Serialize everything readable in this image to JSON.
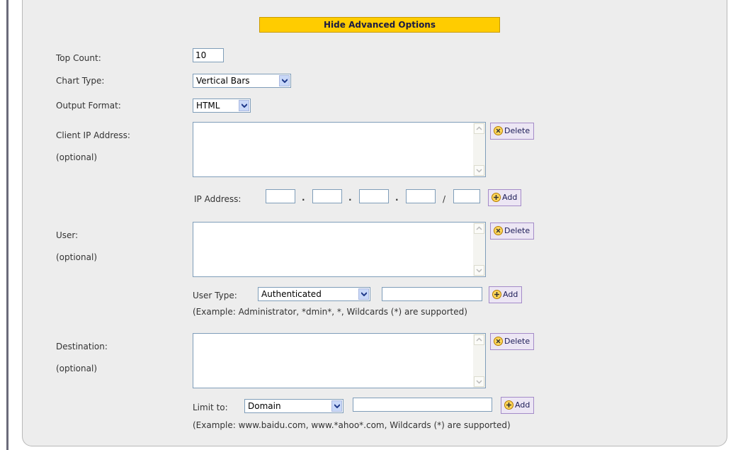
{
  "advanced_toggle": "Hide Advanced Options",
  "top_count": {
    "label": "Top Count:",
    "value": "10"
  },
  "chart_type": {
    "label": "Chart Type:",
    "value": "Vertical Bars"
  },
  "output_format": {
    "label": "Output Format:",
    "value": "HTML"
  },
  "client_ip": {
    "label": "Client IP Address:",
    "optional": "(optional)",
    "delete_label": "Delete",
    "ip_label": "IP Address:",
    "dot": ".",
    "slash": "/",
    "add_label": "Add"
  },
  "user": {
    "label": "User:",
    "optional": "(optional)",
    "delete_label": "Delete",
    "type_label": "User Type:",
    "type_value": "Authenticated",
    "add_label": "Add",
    "example": "(Example: Administrator, *dmin*, *, Wildcards (*) are supported)"
  },
  "destination": {
    "label": "Destination:",
    "optional": "(optional)",
    "delete_label": "Delete",
    "limit_label": "Limit to:",
    "limit_value": "Domain",
    "add_label": "Add",
    "example": "(Example: www.baidu.com, www.*ahoo*.com, Wildcards (*) are supported)"
  }
}
